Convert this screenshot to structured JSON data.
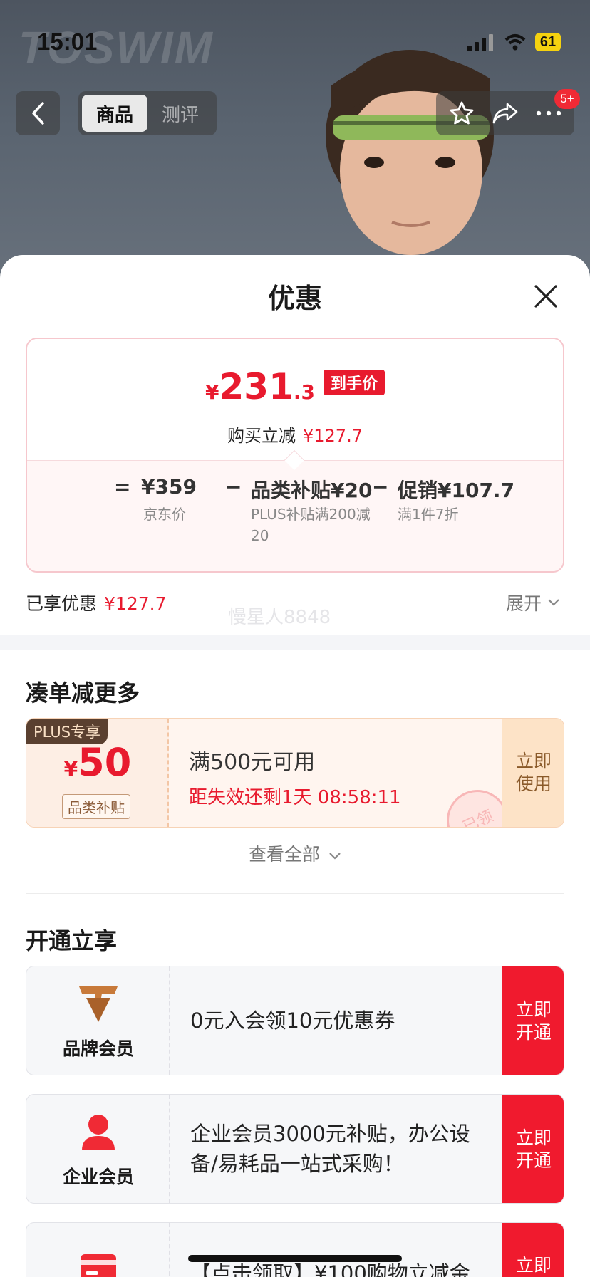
{
  "status_bar": {
    "time": "15:01",
    "battery": "61"
  },
  "backdrop": {
    "brand_text": "TOSWIM",
    "tabs": [
      {
        "label": "商品",
        "active": true
      },
      {
        "label": "测评",
        "active": false
      }
    ],
    "badge": "5+"
  },
  "sheet": {
    "title": "优惠",
    "price": {
      "currency": "¥",
      "integer": "231",
      "decimal": ".3",
      "tag": "到手价",
      "reduce_label": "购买立减",
      "reduce_value": "¥127.7"
    },
    "breakdown": {
      "equals": "=",
      "items": [
        {
          "op": "",
          "label": "¥359",
          "sub": "京东价"
        },
        {
          "op": "−",
          "label": "品类补贴¥20",
          "sub": "PLUS补贴满200减20"
        },
        {
          "op": "−",
          "label": "促销¥107.7",
          "sub": "满1件7折"
        }
      ]
    },
    "enjoyed_label": "已享优惠",
    "enjoyed_value": "¥127.7",
    "expand_label": "展开",
    "watermark": "慢星人8848",
    "section_more": "凑单减更多",
    "coupon": {
      "badge": "PLUS专享",
      "currency": "¥",
      "amount": "50",
      "type": "品类补贴",
      "condition": "满500元可用",
      "expiry": "距失效还剩1天 08:58:11",
      "button": "立即使用",
      "stamp": "已领"
    },
    "view_all": "查看全部",
    "section_open": "开通立享",
    "members": [
      {
        "name": "品牌会员",
        "desc": "0元入会领10元优惠券",
        "button": "立即开通",
        "icon": "brand-v-icon"
      },
      {
        "name": "企业会员",
        "desc": "企业会员3000元补贴，办公设备/易耗品一站式采购！",
        "button": "立即开通",
        "icon": "person-icon"
      },
      {
        "name": "",
        "desc": "【点击领取】¥100购物立减金",
        "button": "立即",
        "icon": "card-icon"
      }
    ]
  },
  "colors": {
    "accent": "#e81a2e",
    "button_red": "#f01a2e",
    "coupon_bg": "#fff5ef"
  }
}
